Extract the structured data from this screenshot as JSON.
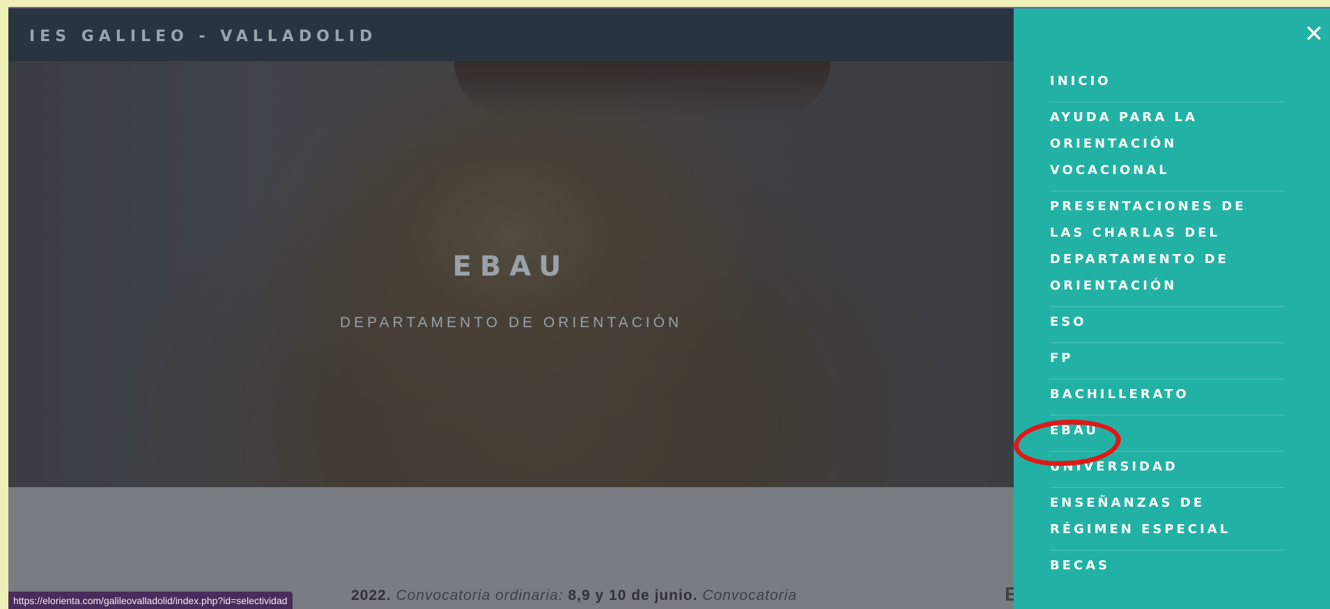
{
  "header": {
    "brand": "IES GALILEO - VALLADOLID"
  },
  "hero": {
    "title": "EBAU",
    "subtitle": "DEPARTAMENTO DE ORIENTACIÓN"
  },
  "content": {
    "line_year": "2022.",
    "line_conv1": "Convocatoria ordinaria:",
    "line_dates": "8,9 y 10 de junio.",
    "line_conv2": "Convocatoria",
    "heading_fragment": "El"
  },
  "status_bar": {
    "url": "https://elorienta.com/galileovalladolid/index.php?id=selectividad"
  },
  "sidebar": {
    "close_icon": "close-icon",
    "items": [
      {
        "label": "INICIO"
      },
      {
        "label": "AYUDA PARA LA ORIENTACIÓN VOCACIONAL"
      },
      {
        "label": "PRESENTACIONES DE LAS CHARLAS DEL DEPARTAMENTO DE ORIENTACIÓN"
      },
      {
        "label": "ESO"
      },
      {
        "label": "FP"
      },
      {
        "label": "BACHILLERATO"
      },
      {
        "label": "EBAU"
      },
      {
        "label": "UNIVERSIDAD"
      },
      {
        "label": "ENSEÑANZAS DE RÉGIMEN ESPECIAL"
      },
      {
        "label": "BECAS"
      }
    ]
  },
  "colors": {
    "sidebar_bg": "#22b2a5",
    "topbar_bg": "#2a3440",
    "annotation_red": "#e01818"
  }
}
